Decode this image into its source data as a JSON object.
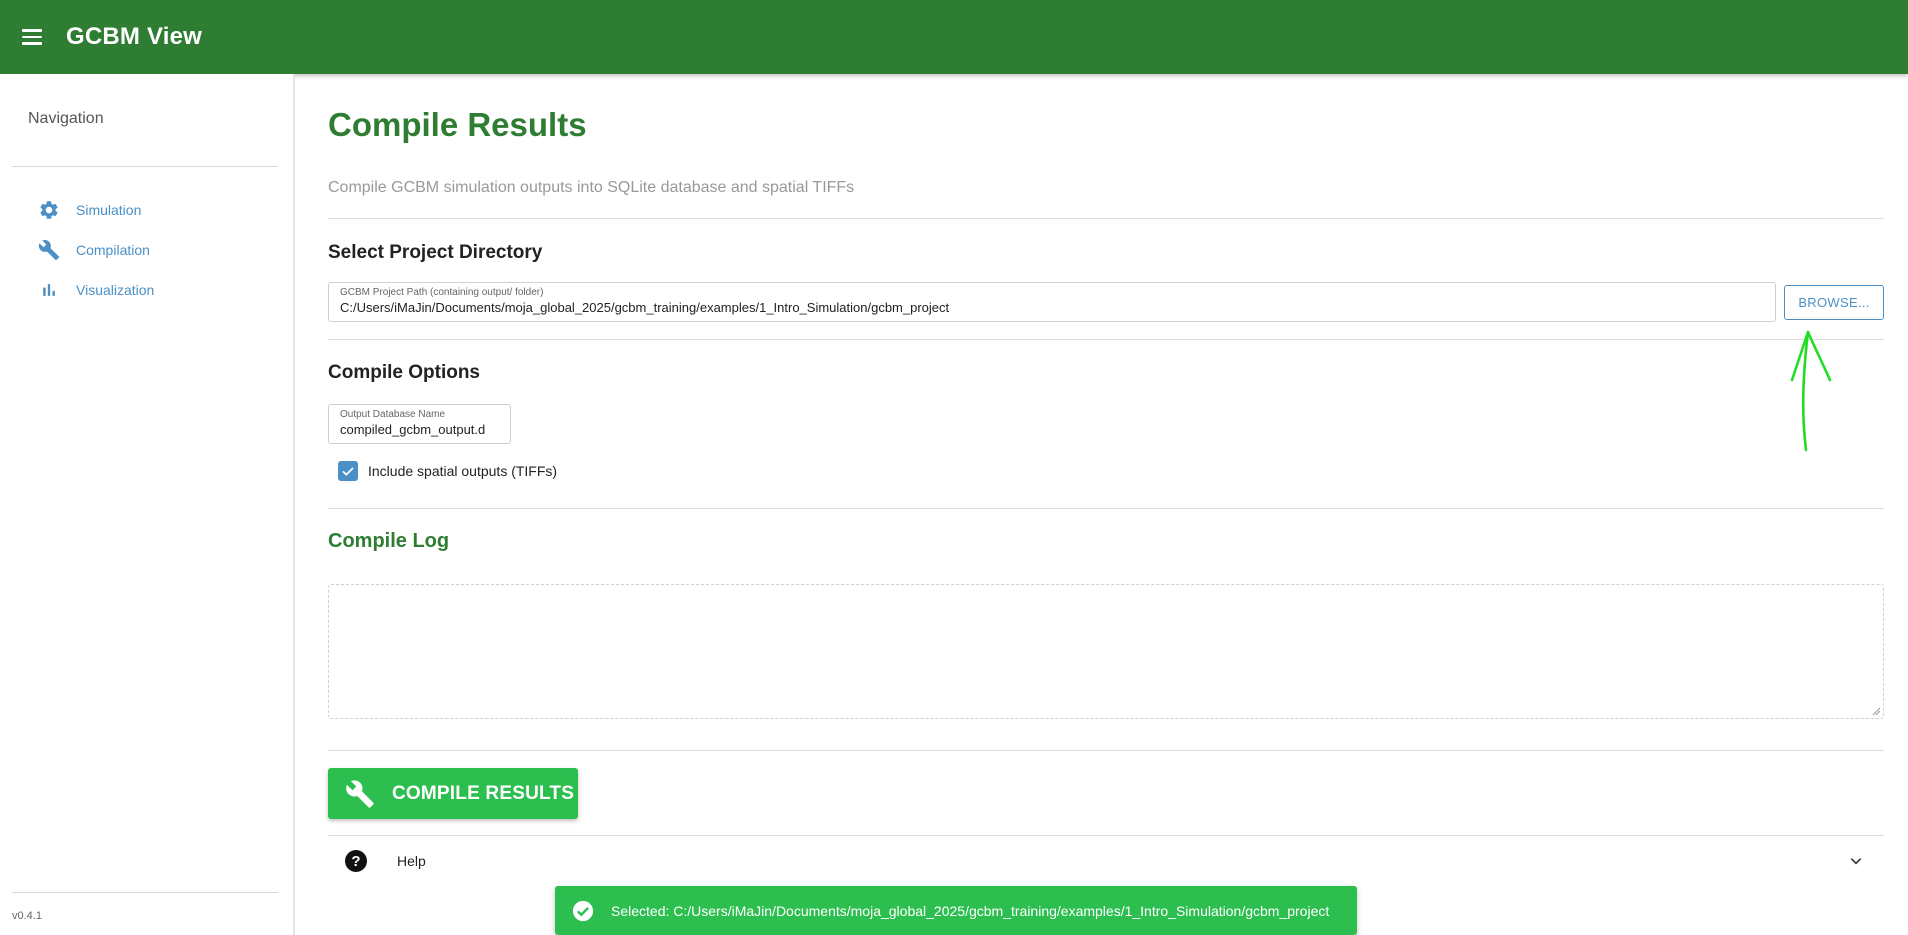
{
  "app": {
    "title": "GCBM View",
    "version": "v0.4.1"
  },
  "sidebar": {
    "title": "Navigation",
    "items": [
      {
        "label": "Simulation",
        "icon": "gear-icon"
      },
      {
        "label": "Compilation",
        "icon": "wrench-icon"
      },
      {
        "label": "Visualization",
        "icon": "bar-chart-icon"
      }
    ]
  },
  "page": {
    "title": "Compile Results",
    "subtitle": "Compile GCBM simulation outputs into SQLite database and spatial TIFFs"
  },
  "project_directory": {
    "heading": "Select Project Directory",
    "path_label": "GCBM Project Path (containing output/ folder)",
    "path_value": "C:/Users/iMaJin/Documents/moja_global_2025/gcbm_training/examples/1_Intro_Simulation/gcbm_project",
    "browse_label": "BROWSE..."
  },
  "compile_options": {
    "heading": "Compile Options",
    "db_label": "Output Database Name",
    "db_value": "compiled_gcbm_output.d",
    "include_spatial_label": "Include spatial outputs (TIFFs)",
    "include_spatial_checked": true
  },
  "compile_log": {
    "heading": "Compile Log",
    "content": ""
  },
  "actions": {
    "compile_label": "COMPILE RESULTS"
  },
  "help": {
    "label": "Help"
  },
  "toast": {
    "message": "Selected: C:/Users/iMaJin/Documents/moja_global_2025/gcbm_training/examples/1_Intro_Simulation/gcbm_project"
  },
  "colors": {
    "primary": "#2e7d32",
    "accent_blue": "#4a90c7",
    "success": "#2cbf4f",
    "annotation": "#22dd22"
  }
}
